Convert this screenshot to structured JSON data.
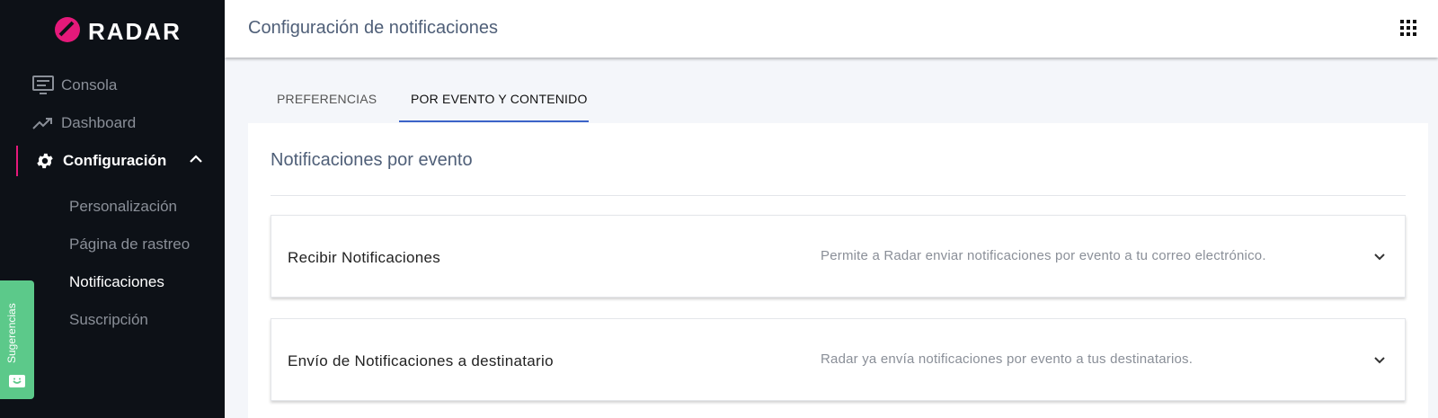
{
  "brand": {
    "name": "RADAR",
    "accent": "#e5197a"
  },
  "sidebar": {
    "items": [
      {
        "label": "Consola",
        "icon": "monitor-icon"
      },
      {
        "label": "Dashboard",
        "icon": "trending-up-icon"
      },
      {
        "label": "Configuración",
        "icon": "gear-icon",
        "active": true
      }
    ],
    "subitems": [
      {
        "label": "Personalización"
      },
      {
        "label": "Página de rastreo"
      },
      {
        "label": "Notificaciones",
        "current": true
      },
      {
        "label": "Suscripción"
      }
    ],
    "feedback_label": "Sugerencias"
  },
  "header": {
    "title": "Configuración de notificaciones"
  },
  "tabs": [
    {
      "label": "PREFERENCIAS"
    },
    {
      "label": "POR EVENTO Y CONTENIDO",
      "selected": true
    }
  ],
  "section": {
    "title": "Notificaciones por evento",
    "panels": [
      {
        "title": "Recibir Notificaciones",
        "description": "Permite a Radar enviar notificaciones por evento a tu correo electrónico."
      },
      {
        "title": "Envío de Notificaciones a destinatario",
        "description": "Radar ya envía notificaciones por evento a tus destinatarios."
      }
    ]
  }
}
